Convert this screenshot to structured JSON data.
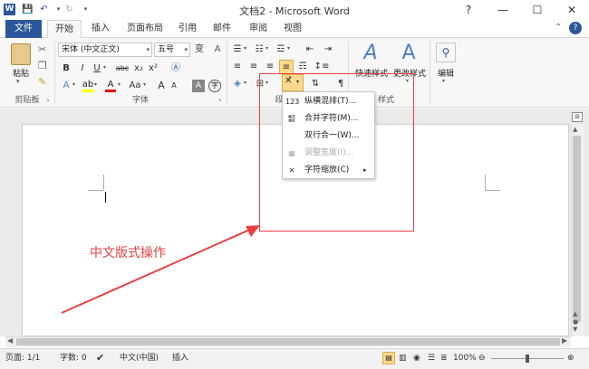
{
  "window": {
    "title": "文档2 - Microsoft Word",
    "controls": [
      "?",
      "—",
      "☐",
      "✕"
    ]
  },
  "tabs": [
    {
      "label": "文件"
    },
    {
      "label": "开始"
    },
    {
      "label": "插入"
    },
    {
      "label": "页面布局"
    },
    {
      "label": "引用"
    },
    {
      "label": "邮件"
    },
    {
      "label": "审阅"
    },
    {
      "label": "视图"
    }
  ],
  "ribbon": {
    "clipboard": {
      "paste_label": "粘贴",
      "group_label": "剪贴板"
    },
    "font": {
      "font_name": "宋体 (中文正文)",
      "font_size": "五号",
      "group_label": "字体",
      "btn_wen": "变",
      "btn_a_big": "A",
      "btn_a_small": "A",
      "btn_aa": "Aa",
      "btn_bold": "B",
      "btn_italic": "I",
      "btn_underline": "U",
      "btn_strike": "abc",
      "btn_sub": "x₂",
      "btn_sup": "x²"
    },
    "paragraph": {
      "group_label_fragment": "段",
      "btn_zhong": "中"
    },
    "styles": {
      "quick_label": "快速样式",
      "change_label": "更改样式",
      "group_label_fragment": "样式"
    },
    "editing": {
      "label": "编辑"
    }
  },
  "menu": {
    "items": [
      {
        "label": "纵横混排(T)...",
        "enabled": true
      },
      {
        "label": "合并字符(M)...",
        "enabled": true
      },
      {
        "label": "双行合一(W)...",
        "enabled": true
      },
      {
        "label": "调整宽度(I)...",
        "enabled": false
      },
      {
        "label": "字符缩放(C)",
        "enabled": true,
        "submenu": true
      }
    ]
  },
  "annotation": {
    "text": "中文版式操作",
    "color": "#e84040"
  },
  "statusbar": {
    "page": "页面: 1/1",
    "words": "字数: 0",
    "language": "中文(中国)",
    "insert": "插入",
    "zoom": "100%"
  },
  "colors": {
    "accent": "#2b579a",
    "annotation": "#e84040",
    "highlight": "#fcd98c"
  }
}
